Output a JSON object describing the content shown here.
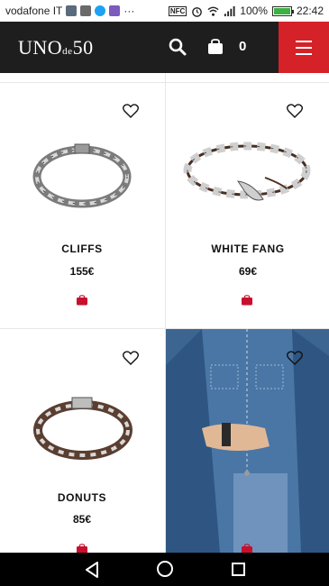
{
  "status_bar": {
    "carrier": "vodafone IT",
    "more": "···",
    "nfc": "NFC",
    "battery_level": "100%",
    "time": "22:42"
  },
  "header": {
    "logo_main": "UNO",
    "logo_small": "de",
    "logo_num": "50",
    "cart_count": "0"
  },
  "products": [
    {
      "name": "CLIFFS",
      "price": "155€"
    },
    {
      "name": "WHITE FANG",
      "price": "69€"
    },
    {
      "name": "DONUTS",
      "price": "85€"
    }
  ],
  "colors": {
    "header_bg": "#1e1e1e",
    "menu_red": "#d42228",
    "cart_red": "#c8102e",
    "battery_green": "#3cb043"
  },
  "icons": [
    "search-icon",
    "shopping-bag-icon",
    "hamburger-menu-icon",
    "heart-icon",
    "cart-icon",
    "back-icon",
    "home-icon",
    "recent-apps-icon"
  ]
}
